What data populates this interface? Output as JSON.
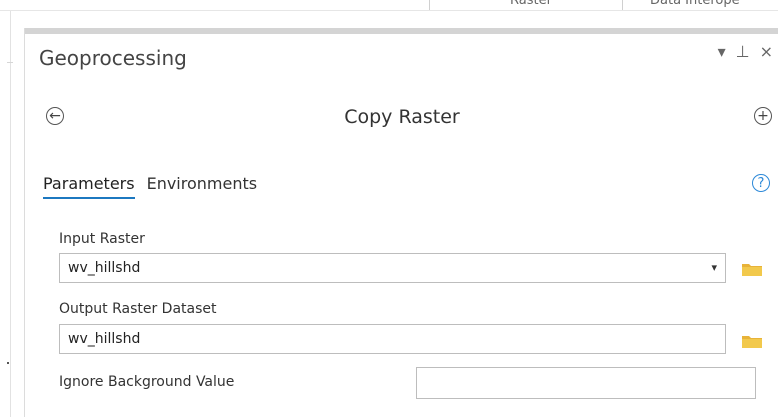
{
  "ribbon": {
    "left_text": "Raster",
    "right_text": "Data Interope"
  },
  "pane": {
    "title": "Geoprocessing",
    "controls": {
      "dropdown_glyph": "▾",
      "pin_glyph": "⊥",
      "close_glyph": "×"
    }
  },
  "tool": {
    "name": "Copy Raster",
    "back_glyph": "←",
    "add_glyph": "+"
  },
  "tabs": [
    {
      "label": "Parameters",
      "active": true
    },
    {
      "label": "Environments",
      "active": false
    }
  ],
  "help_glyph": "?",
  "params": {
    "input_raster": {
      "label": "Input Raster",
      "value": "wv_hillshd",
      "dropdown_glyph": "▾"
    },
    "output_raster": {
      "label": "Output Raster Dataset",
      "value": "wv_hillshd"
    },
    "ignore_background": {
      "label": "Ignore Background Value",
      "value": ""
    }
  },
  "colors": {
    "accent_blue": "#1c78c0",
    "help_blue": "#2b88d8",
    "folder_yellow": "#f2c94c"
  },
  "icons": {
    "folder": "folder-icon",
    "help": "help-icon",
    "back": "back-arrow-icon",
    "add": "add-icon",
    "pin": "pin-icon",
    "close": "close-icon",
    "menu": "menu-dropdown-icon"
  }
}
